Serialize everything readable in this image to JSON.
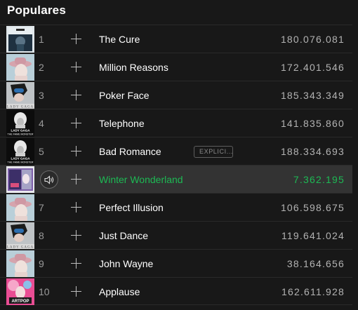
{
  "section": {
    "title": "Populares"
  },
  "tracks": [
    {
      "num": "1",
      "name": "The Cure",
      "plays": "180.076.081",
      "cover": "single-cure",
      "explicit": false,
      "playing": false
    },
    {
      "num": "2",
      "name": "Million Reasons",
      "plays": "172.401.546",
      "cover": "joanne",
      "explicit": false,
      "playing": false
    },
    {
      "num": "3",
      "name": "Poker Face",
      "plays": "185.343.349",
      "cover": "the-fame",
      "explicit": false,
      "playing": false
    },
    {
      "num": "4",
      "name": "Telephone",
      "plays": "141.835.860",
      "cover": "the-fame-monster",
      "explicit": false,
      "playing": false
    },
    {
      "num": "5",
      "name": "Bad Romance",
      "plays": "188.334.693",
      "cover": "the-fame-monster",
      "explicit": true,
      "explicit_label": "EXPLICI...",
      "playing": false
    },
    {
      "num": "6",
      "name": "Winter Wonderland",
      "plays": "7.362.195",
      "cover": "holiday",
      "explicit": false,
      "playing": true
    },
    {
      "num": "7",
      "name": "Perfect Illusion",
      "plays": "106.598.675",
      "cover": "joanne",
      "explicit": false,
      "playing": false
    },
    {
      "num": "8",
      "name": "Just Dance",
      "plays": "119.641.024",
      "cover": "the-fame",
      "explicit": false,
      "playing": false
    },
    {
      "num": "9",
      "name": "John Wayne",
      "plays": "38.164.656",
      "cover": "joanne",
      "explicit": false,
      "playing": false
    },
    {
      "num": "10",
      "name": "Applause",
      "plays": "162.611.928",
      "cover": "artpop",
      "explicit": false,
      "playing": false
    }
  ],
  "cover_text": {
    "the-fame": "LADY GAGA",
    "the-fame-monster": [
      "LADY GAGA",
      "THE FAME MONSTER"
    ],
    "artpop": "ARTPOP"
  },
  "icons": {
    "add": "plus-icon",
    "now_playing": "speaker-icon"
  },
  "colors": {
    "background": "#181818",
    "active_row": "#333333",
    "accent": "#1db954",
    "muted_text": "#b3b3b3"
  }
}
